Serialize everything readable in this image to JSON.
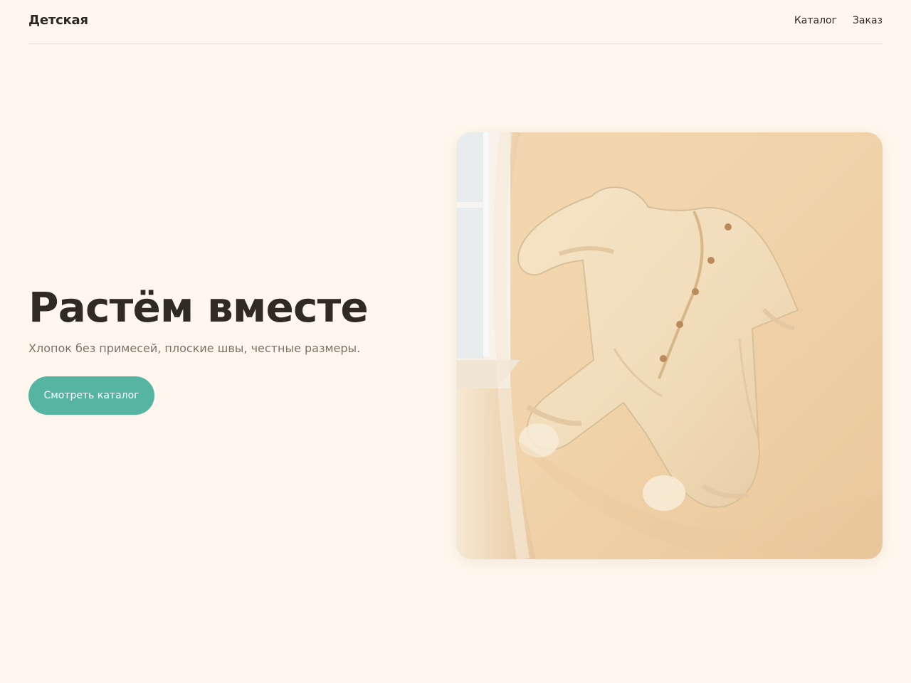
{
  "header": {
    "brand": "Детская",
    "nav": [
      {
        "label": "Каталог"
      },
      {
        "label": "Заказ"
      }
    ]
  },
  "hero": {
    "title": "Растём вместе",
    "subtitle": "Хлопок без примесей, плоские швы, честные размеры.",
    "button_label": "Смотреть каталог"
  },
  "colors": {
    "background": "#fff7ed",
    "accent": "#55b5a2",
    "text": "#312a22",
    "muted_text": "#7a7167"
  }
}
